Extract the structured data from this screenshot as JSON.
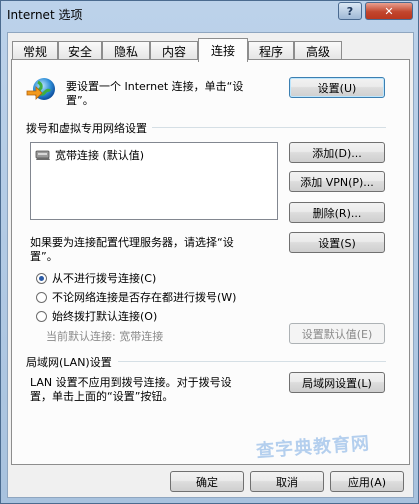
{
  "window": {
    "title": "Internet 选项",
    "help_label": "?",
    "close_label": "✕"
  },
  "tabs": [
    {
      "label": "常规"
    },
    {
      "label": "安全"
    },
    {
      "label": "隐私"
    },
    {
      "label": "内容"
    },
    {
      "label": "连接"
    },
    {
      "label": "程序"
    },
    {
      "label": "高级"
    }
  ],
  "active_tab": "连接",
  "setup": {
    "text_line1": "要设置一个 Internet 连接，单击“设",
    "text_line2": "置”。",
    "button_label": "设置(U)"
  },
  "dialup": {
    "header": "拨号和虚拟专用网络设置",
    "items": [
      {
        "label": "宽带连接 (默认值)"
      }
    ],
    "add_label": "添加(D)...",
    "add_vpn_label": "添加 VPN(P)...",
    "remove_label": "删除(R)...",
    "proxy_text_line1": "如果要为连接配置代理服务器，请选择“设",
    "proxy_text_line2": "置”。",
    "settings_label": "设置(S)"
  },
  "dial_options": [
    {
      "label": "从不进行拨号连接(C)",
      "selected": true
    },
    {
      "label": "不论网络连接是否存在都进行拨号(W)",
      "selected": false
    },
    {
      "label": "始终拨打默认连接(O)",
      "selected": false
    }
  ],
  "current_default": {
    "label": "当前默认连接: 宽带连接",
    "set_default_label": "设置默认值(E)"
  },
  "lan": {
    "header": "局域网(LAN)设置",
    "text_line1": "LAN 设置不应用到拨号连接。对于拨号设",
    "text_line2": "置，单击上面的“设置”按钮。",
    "button_label": "局域网设置(L)"
  },
  "footer": {
    "ok_label": "确定",
    "cancel_label": "取消",
    "apply_label": "应用(A)"
  },
  "watermark": "查字典教育网"
}
